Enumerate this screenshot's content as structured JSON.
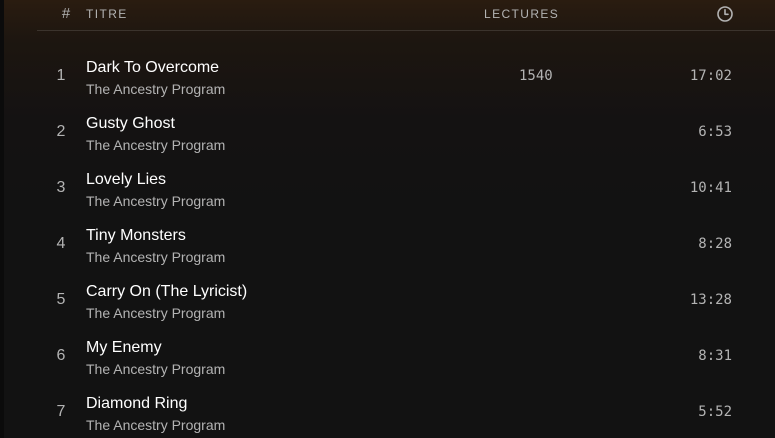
{
  "header": {
    "number_label": "#",
    "title_label": "TITRE",
    "plays_label": "LECTURES",
    "duration_icon": "clock-icon"
  },
  "tracks": [
    {
      "number": "1",
      "title": "Dark To Overcome",
      "artist": "The Ancestry Program",
      "plays": "1540",
      "duration": "17:02"
    },
    {
      "number": "2",
      "title": "Gusty Ghost",
      "artist": "The Ancestry Program",
      "plays": "",
      "duration": "6:53"
    },
    {
      "number": "3",
      "title": "Lovely Lies",
      "artist": "The Ancestry Program",
      "plays": "",
      "duration": "10:41"
    },
    {
      "number": "4",
      "title": "Tiny Monsters",
      "artist": "The Ancestry Program",
      "plays": "",
      "duration": "8:28"
    },
    {
      "number": "5",
      "title": "Carry On (The Lyricist)",
      "artist": "The Ancestry Program",
      "plays": "",
      "duration": "13:28"
    },
    {
      "number": "6",
      "title": "My Enemy",
      "artist": "The Ancestry Program",
      "plays": "",
      "duration": "8:31"
    },
    {
      "number": "7",
      "title": "Diamond Ring",
      "artist": "The Ancestry Program",
      "plays": "",
      "duration": "5:52"
    }
  ]
}
